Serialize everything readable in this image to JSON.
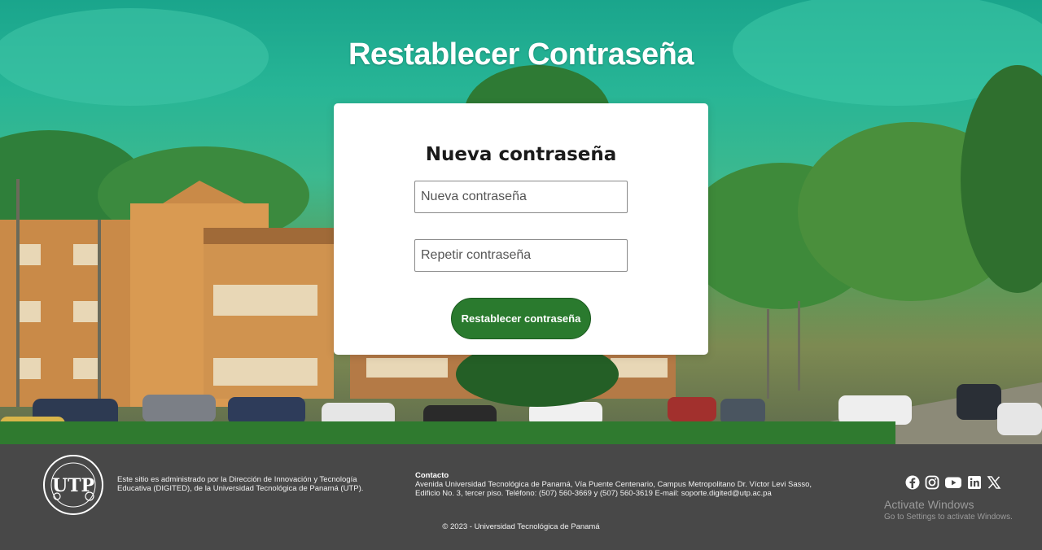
{
  "page": {
    "title": "Restablecer Contraseña"
  },
  "form": {
    "heading": "Nueva contraseña",
    "new_password_placeholder": "Nueva contraseña",
    "repeat_password_placeholder": "Repetir contraseña",
    "submit_label": "Restablecer contraseña",
    "submit_color": "#2a7a2e"
  },
  "footer": {
    "about": "Este sitio es administrado por la Dirección de Innovación y Tecnología Educativa (DIGITED), de la Universidad Tecnológica de Panamá (UTP).",
    "contact_heading": "Contacto",
    "contact_text": "Avenida Universidad Tecnológica de Panamá, Vía Puente Centenario, Campus Metropolitano Dr. Víctor Levi Sasso, Edificio No. 3, tercer piso. Teléfono: (507) 560-3669 y (507) 560-3619 E-mail: soporte.digited@utp.ac.pa",
    "copyright": "© 2023 - Universidad Tecnológica de Panamá",
    "logo_icon": "utp-seal-logo",
    "social_icons": [
      "facebook-icon",
      "instagram-icon",
      "youtube-icon",
      "linkedin-icon",
      "x-icon"
    ],
    "background": "#484848"
  },
  "windows_watermark": {
    "line1": "Activate Windows",
    "line2": "Go to Settings to activate Windows."
  }
}
